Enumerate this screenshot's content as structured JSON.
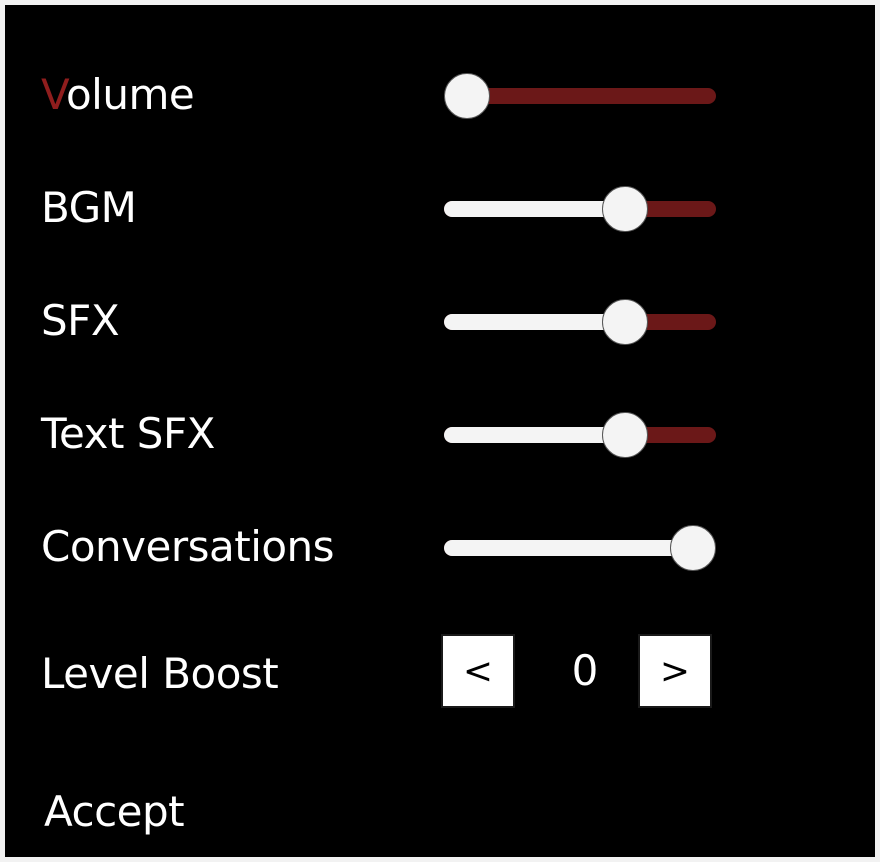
{
  "settings": [
    {
      "label_first": "V",
      "label_rest": "olume",
      "value": 0.0
    },
    {
      "label": "BGM",
      "value": 0.7
    },
    {
      "label": "SFX",
      "value": 0.7
    },
    {
      "label": "Text SFX",
      "value": 0.7
    },
    {
      "label": "Conversations",
      "value": 1.0
    }
  ],
  "level_boost": {
    "label": "Level Boost",
    "value": "0",
    "decrement": "<",
    "increment": ">"
  },
  "accept_label": "Accept",
  "colors": {
    "accent": "#8f1d1d",
    "track_empty": "#6b1818",
    "track_fill": "#f4f4f4",
    "background": "#000000"
  }
}
